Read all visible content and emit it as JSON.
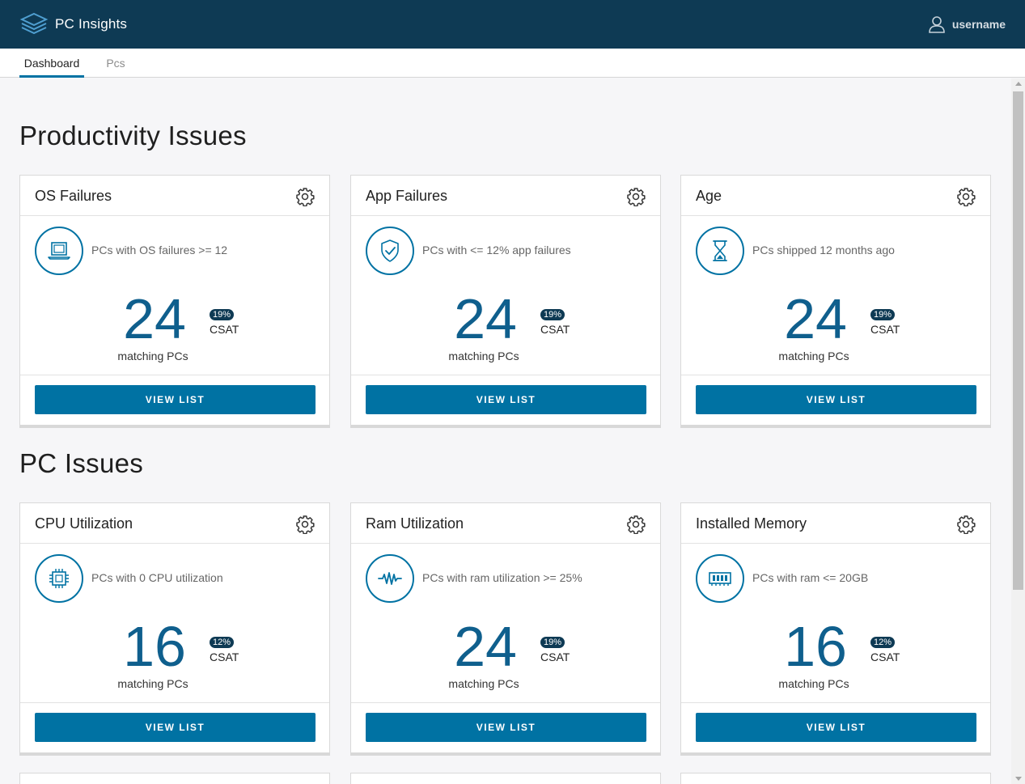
{
  "app": {
    "title": "PC Insights",
    "username": "username"
  },
  "tabs": [
    {
      "label": "Dashboard",
      "active": true
    },
    {
      "label": "Pcs",
      "active": false
    }
  ],
  "colors": {
    "header": "#0e3a54",
    "accent": "#0072a3",
    "number": "#0f5f8d"
  },
  "sections": [
    {
      "title": "Productivity Issues",
      "cards": [
        {
          "title": "OS Failures",
          "icon": "laptop-icon",
          "description": "PCs with OS failures >= 12",
          "count": "24",
          "csat_percent": "19%",
          "csat_label": "CSAT",
          "matching_label": "matching PCs",
          "button": "VIEW LIST"
        },
        {
          "title": "App Failures",
          "icon": "shield-check-icon",
          "description": "PCs with <= 12% app failures",
          "count": "24",
          "csat_percent": "19%",
          "csat_label": "CSAT",
          "matching_label": "matching PCs",
          "button": "VIEW LIST"
        },
        {
          "title": "Age",
          "icon": "hourglass-icon",
          "description": "PCs shipped 12 months ago",
          "count": "24",
          "csat_percent": "19%",
          "csat_label": "CSAT",
          "matching_label": "matching PCs",
          "button": "VIEW LIST"
        }
      ]
    },
    {
      "title": "PC Issues",
      "cards": [
        {
          "title": "CPU Utilization",
          "icon": "cpu-icon",
          "description": "PCs with 0 CPU utilization",
          "count": "16",
          "csat_percent": "12%",
          "csat_label": "CSAT",
          "matching_label": "matching PCs",
          "button": "VIEW LIST"
        },
        {
          "title": "Ram Utilization",
          "icon": "waveform-icon",
          "description": "PCs with ram utilization >= 25%",
          "count": "24",
          "csat_percent": "19%",
          "csat_label": "CSAT",
          "matching_label": "matching PCs",
          "button": "VIEW LIST"
        },
        {
          "title": "Installed Memory",
          "icon": "memory-icon",
          "description": "PCs with ram <= 20GB",
          "count": "16",
          "csat_percent": "12%",
          "csat_label": "CSAT",
          "matching_label": "matching PCs",
          "button": "VIEW LIST"
        }
      ]
    }
  ]
}
